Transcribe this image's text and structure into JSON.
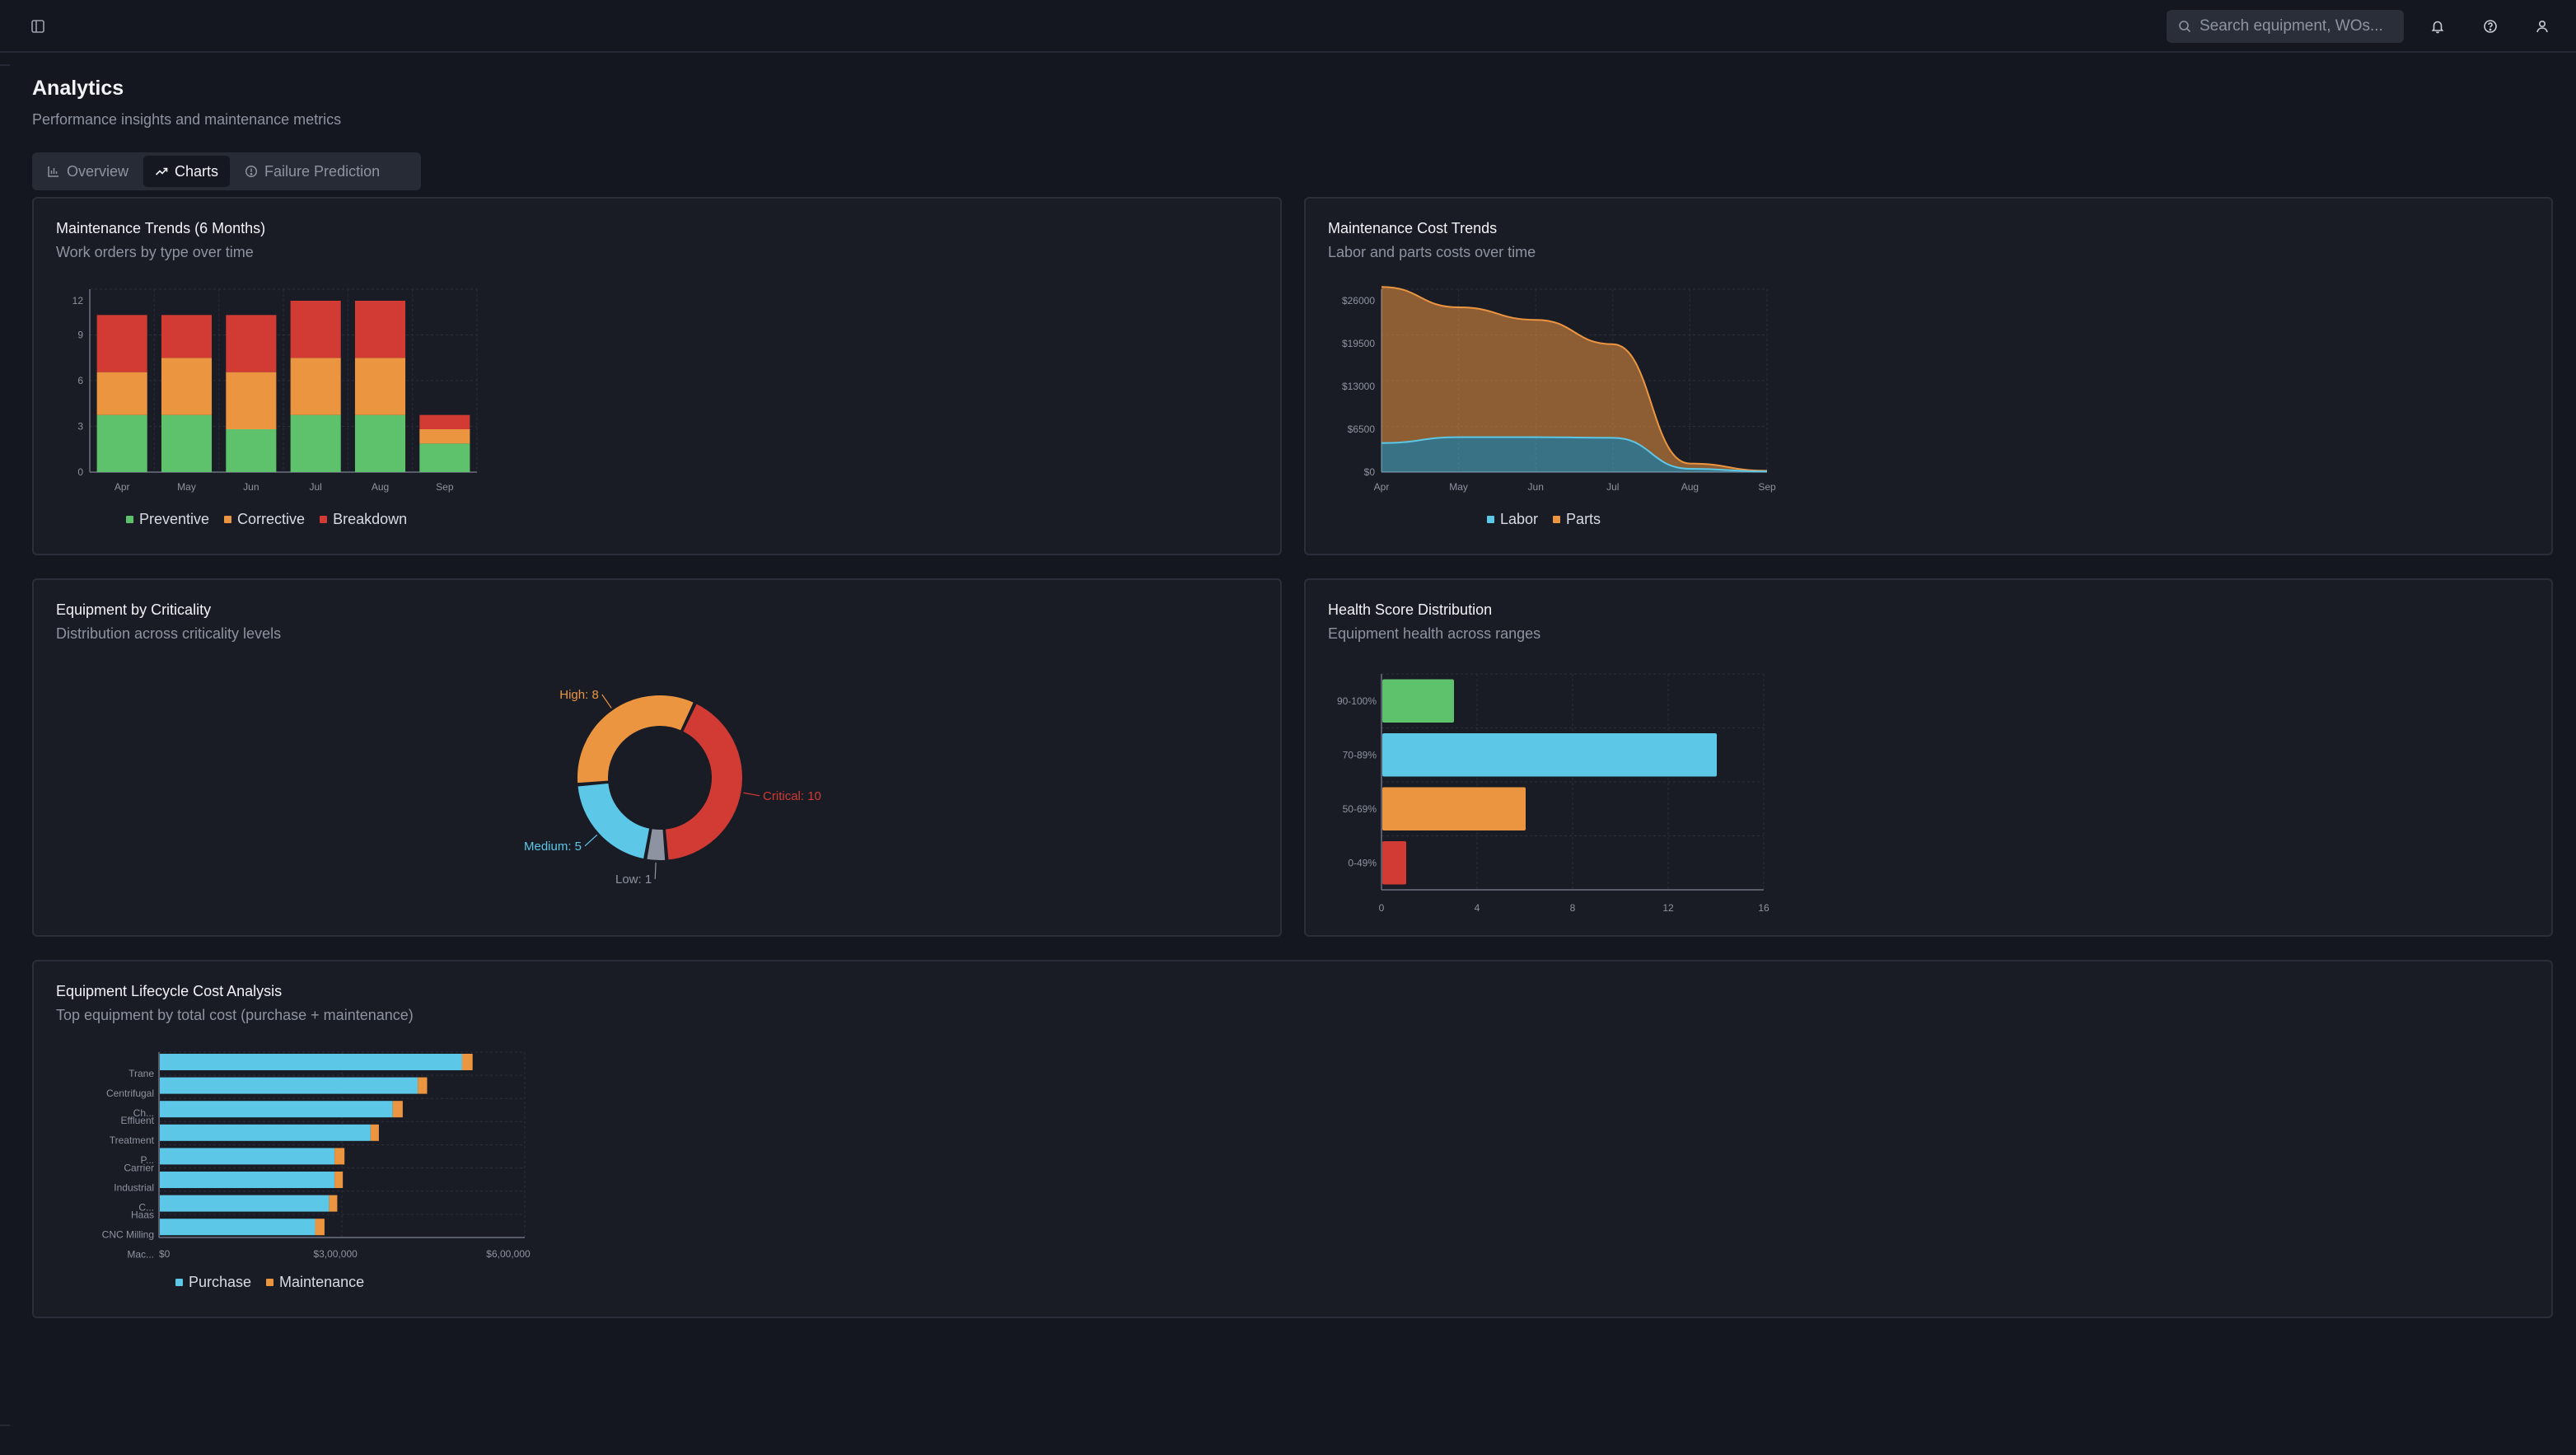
{
  "topbar": {
    "search_placeholder": "Search equipment, WOs..."
  },
  "icons": {
    "sidebar": "sidebar-toggle-icon",
    "search": "search-icon",
    "bell": "bell-icon",
    "help": "help-circle-icon",
    "user": "user-icon"
  },
  "page": {
    "title": "Analytics",
    "subtitle": "Performance insights and maintenance metrics"
  },
  "tabs": [
    {
      "label": "Overview",
      "icon": "bar-chart-icon",
      "active": false
    },
    {
      "label": "Charts",
      "icon": "trending-up-icon",
      "active": true
    },
    {
      "label": "Failure Prediction",
      "icon": "alert-circle-icon",
      "active": false
    }
  ],
  "colors": {
    "preventive": "#5ec16c",
    "corrective": "#ec9540",
    "breakdown": "#d23a34",
    "labor": "#5cc7e6",
    "parts": "#ec9540",
    "low": "#8d93a0",
    "grid": "#2a2e3a",
    "axis_text": "#8d93a0"
  },
  "cards": {
    "trends": {
      "title": "Maintenance Trends (6 Months)",
      "subtitle": "Work orders by type over time"
    },
    "cost": {
      "title": "Maintenance Cost Trends",
      "subtitle": "Labor and parts costs over time"
    },
    "criticality": {
      "title": "Equipment by Criticality",
      "subtitle": "Distribution across criticality levels"
    },
    "health": {
      "title": "Health Score Distribution",
      "subtitle": "Equipment health across ranges"
    },
    "lifecycle": {
      "title": "Equipment Lifecycle Cost Analysis",
      "subtitle": "Top equipment by total cost (purchase + maintenance)"
    }
  },
  "chart_data": [
    {
      "id": "trends",
      "type": "bar",
      "stacked": true,
      "categories": [
        "Apr",
        "May",
        "Jun",
        "Jul",
        "Aug",
        "Sep"
      ],
      "series": [
        {
          "name": "Preventive",
          "values": [
            4,
            4,
            3,
            4,
            4,
            2
          ]
        },
        {
          "name": "Corrective",
          "values": [
            3,
            4,
            4,
            4,
            4,
            1
          ]
        },
        {
          "name": "Breakdown",
          "values": [
            4,
            3,
            4,
            4,
            4,
            1
          ]
        }
      ],
      "ylim": [
        0,
        12
      ],
      "yticks": [
        "0",
        "3",
        "6",
        "9",
        "12"
      ],
      "grid": true,
      "legend": "bottom"
    },
    {
      "id": "cost",
      "type": "area",
      "stacked": true,
      "x": [
        "Apr",
        "May",
        "Jun",
        "Jul",
        "Aug",
        "Sep"
      ],
      "series": [
        {
          "name": "Labor",
          "values": [
            4400,
            5300,
            5300,
            5200,
            500,
            100
          ]
        },
        {
          "name": "Parts",
          "values": [
            23700,
            19700,
            17800,
            14200,
            800,
            100
          ]
        }
      ],
      "ylim": [
        0,
        26000
      ],
      "yticks": [
        "$0",
        "$6500",
        "$13000",
        "$19500",
        "$26000"
      ],
      "grid": true,
      "legend": "bottom"
    },
    {
      "id": "criticality",
      "type": "pie",
      "donut": true,
      "slices": [
        {
          "name": "Critical",
          "value": 10,
          "label": "Critical: 10"
        },
        {
          "name": "Low",
          "value": 1,
          "label": "Low: 1"
        },
        {
          "name": "Medium",
          "value": 5,
          "label": "Medium: 5"
        },
        {
          "name": "High",
          "value": 8,
          "label": "High: 8"
        }
      ]
    },
    {
      "id": "health",
      "type": "bar",
      "orientation": "horizontal",
      "categories": [
        "90-100%",
        "70-89%",
        "50-69%",
        "0-49%"
      ],
      "values": [
        3,
        14,
        6,
        1
      ],
      "xlim": [
        0,
        16
      ],
      "xticks": [
        "0",
        "4",
        "8",
        "12",
        "16"
      ],
      "grid": true
    },
    {
      "id": "lifecycle",
      "type": "bar",
      "orientation": "horizontal",
      "stacked": true,
      "categories": [
        "Trane Centrifugal Ch...",
        "Effluent Treatment P...",
        "Carrier Industrial C...",
        "Haas CNC Milling Mac..."
      ],
      "series": [
        {
          "name": "Purchase",
          "values": [
            545000,
            465000,
            420000,
            380000,
            315000,
            315000,
            305000,
            280000
          ]
        },
        {
          "name": "Maintenance",
          "values": [
            10000,
            8000,
            9000,
            6000,
            9000,
            6000,
            6000,
            8000
          ]
        }
      ],
      "xlim": [
        0,
        600000
      ],
      "xticks": [
        "$0",
        "$3,00,000",
        "$6,00,000"
      ],
      "grid": true,
      "legend": "bottom"
    }
  ]
}
